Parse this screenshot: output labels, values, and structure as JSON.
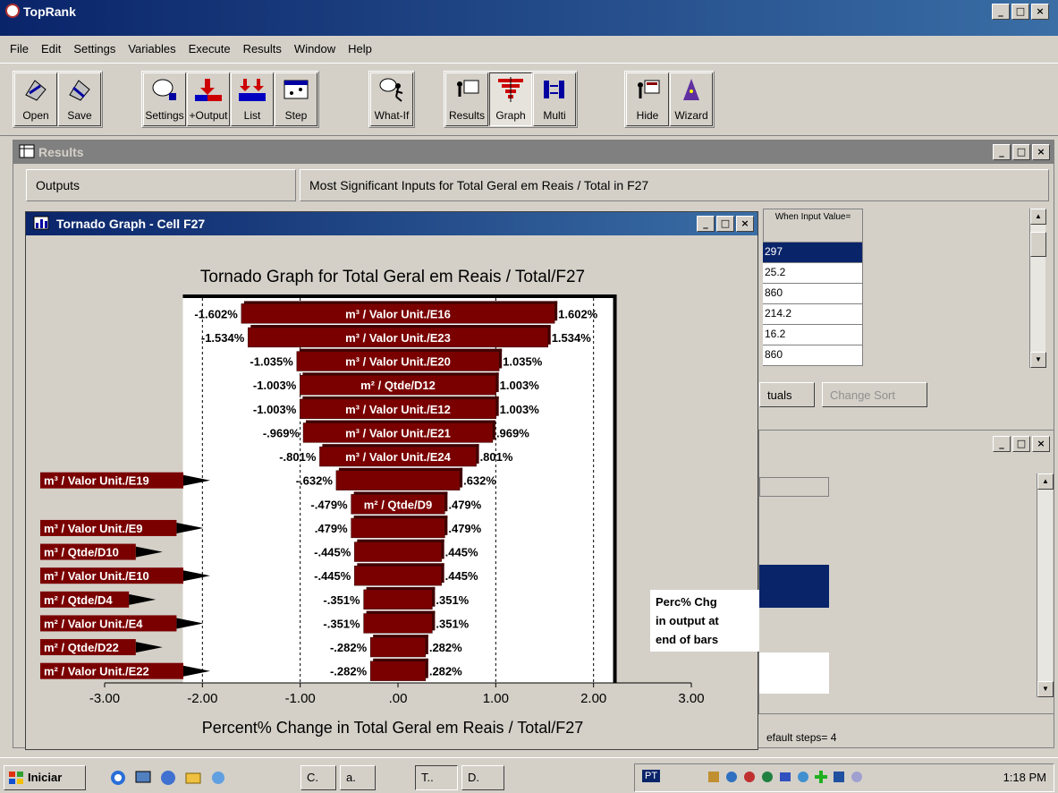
{
  "app": {
    "title": "TopRank"
  },
  "menu": [
    "File",
    "Edit",
    "Settings",
    "Variables",
    "Execute",
    "Results",
    "Window",
    "Help"
  ],
  "toolbar": {
    "group1": [
      {
        "label": "Open",
        "icon": "open-icon"
      },
      {
        "label": "Save",
        "icon": "save-icon"
      }
    ],
    "group2": [
      {
        "label": "Settings",
        "icon": "settings-icon"
      },
      {
        "label": "+Output",
        "icon": "add-output-icon"
      },
      {
        "label": "List",
        "icon": "list-icon"
      },
      {
        "label": "Step",
        "icon": "step-icon"
      }
    ],
    "group3": [
      {
        "label": "What-If",
        "icon": "what-if-icon"
      }
    ],
    "group4": [
      {
        "label": "Results",
        "icon": "results-icon"
      },
      {
        "label": "Graph",
        "icon": "graph-icon"
      },
      {
        "label": "Multi",
        "icon": "multi-icon"
      }
    ],
    "group5": [
      {
        "label": "Hide",
        "icon": "hide-icon"
      },
      {
        "label": "Wizard",
        "icon": "wizard-icon"
      }
    ]
  },
  "results_window": {
    "title": "Results",
    "outputs_header": "Outputs",
    "inputs_header": "Most Significant Inputs for Total Geral em Reais / Total in F27",
    "grid_header": "When Input Value=",
    "grid_values": [
      "297",
      "25.2",
      "860",
      "214.2",
      "16.2",
      "860"
    ],
    "actuals_label": "tuals",
    "change_sort_label": "Change Sort",
    "status": "efault steps= 4"
  },
  "tornado_window": {
    "title": "Tornado Graph - Cell F27",
    "note_lines": [
      "Perc% Chg",
      "in output at",
      "end of bars"
    ]
  },
  "chart_data": {
    "type": "bar",
    "title": "Tornado Graph for Total Geral em Reais / Total/F27",
    "xlabel": "Percent% Change in Total Geral em Reais / Total/F27",
    "xlim": [
      -3.0,
      3.0
    ],
    "xticks": [
      "-3.00",
      "-2.00",
      "-1.00",
      ".00",
      "1.00",
      "2.00",
      "3.00"
    ],
    "categories": [
      "m³ / Valor Unit./E16",
      "m³ / Valor Unit./E23",
      "m³ / Valor Unit./E20",
      "m² / Qtde/D12",
      "m³ / Valor Unit./E12",
      "m³ / Valor Unit./E21",
      "m³ / Valor Unit./E24",
      "m³ / Valor Unit./E19",
      "m² / Qtde/D9",
      "m³ / Valor Unit./E9",
      "m³ / Qtde/D10",
      "m³ / Valor Unit./E10",
      "m² / Qtde/D4",
      "m² / Valor Unit./E4",
      "m² / Qtde/D22",
      "m² / Valor Unit./E22"
    ],
    "low_labels": [
      "-1.602%",
      "-1.534%",
      "-1.035%",
      "-1.003%",
      "-1.003%",
      "-.969%",
      "-.801%",
      "-.632%",
      "-.479%",
      ".479%",
      "-.445%",
      "-.445%",
      "-.351%",
      "-.351%",
      "-.282%",
      "-.282%"
    ],
    "high_labels": [
      "1.602%",
      "1.534%",
      "1.035%",
      "1.003%",
      "1.003%",
      ".969%",
      ".801%",
      ".632%",
      ".479%",
      ".479%",
      ".445%",
      ".445%",
      ".351%",
      ".351%",
      ".282%",
      ".282%"
    ],
    "low_values": [
      -1.602,
      -1.534,
      -1.035,
      -1.003,
      -1.003,
      -0.969,
      -0.801,
      -0.632,
      -0.479,
      -0.479,
      -0.445,
      -0.445,
      -0.351,
      -0.351,
      -0.282,
      -0.282
    ],
    "high_values": [
      1.602,
      1.534,
      1.035,
      1.003,
      1.003,
      0.969,
      0.801,
      0.632,
      0.479,
      0.479,
      0.445,
      0.445,
      0.351,
      0.351,
      0.282,
      0.282
    ],
    "label_outside": [
      false,
      false,
      false,
      false,
      false,
      false,
      false,
      true,
      false,
      true,
      true,
      true,
      true,
      true,
      true,
      true
    ],
    "bar_color": "#7a0000"
  },
  "taskbar": {
    "start_label": "Iniciar",
    "items": [
      "C.",
      "a.",
      "T..",
      "D."
    ],
    "lang": "PT",
    "time": "1:18 PM"
  }
}
